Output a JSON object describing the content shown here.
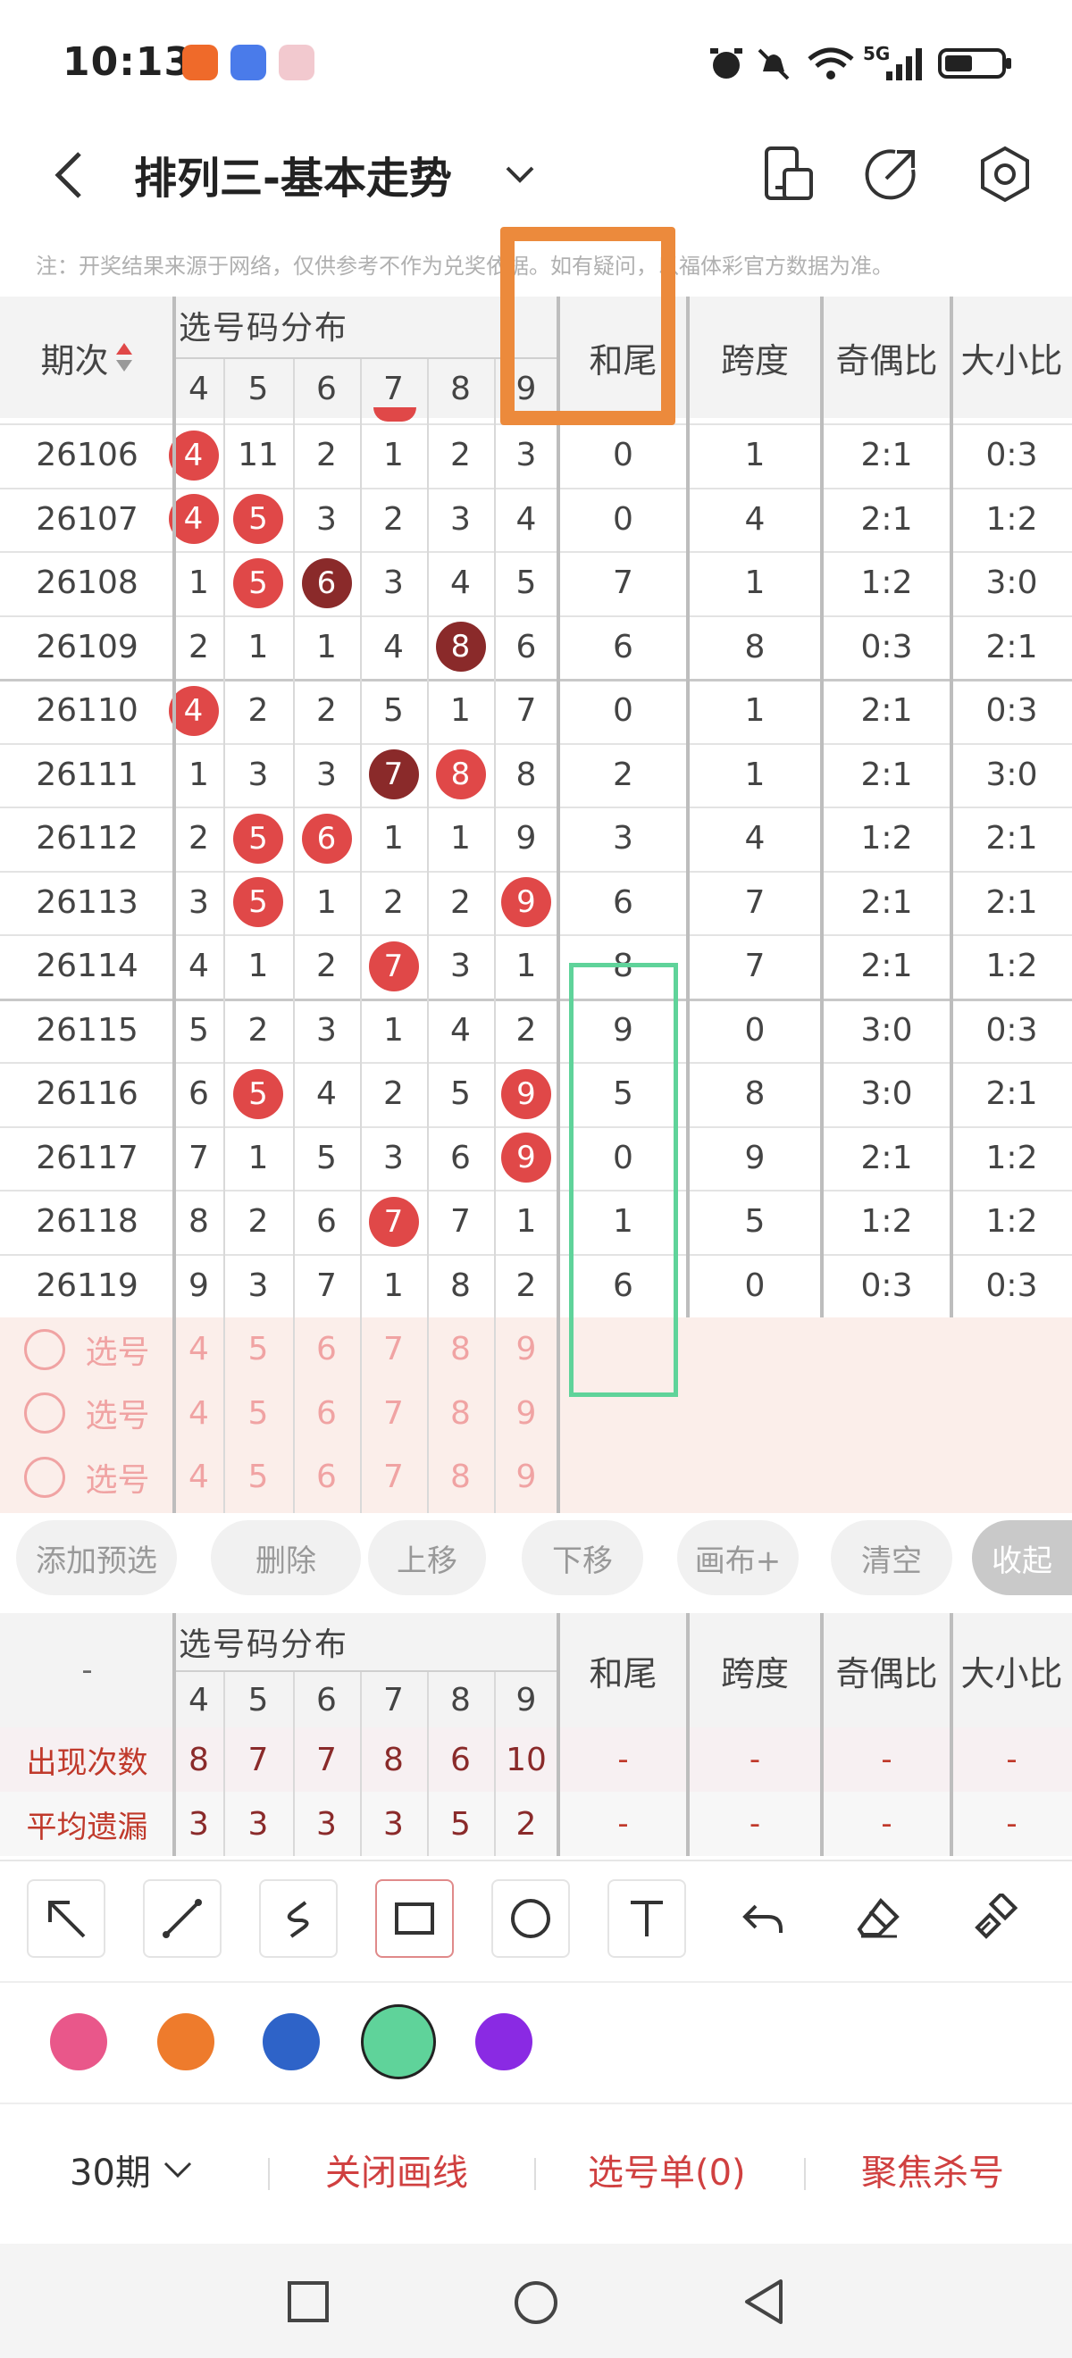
{
  "status_bar": {
    "time": "10:13",
    "network": "5G"
  },
  "header": {
    "title": "排列三-基本走势"
  },
  "notice": "注：开奖结果来源于网络，仅供参考不作为兑奖依据。如有疑问，以福体彩官方数据为准。",
  "table": {
    "issue_header": "期次",
    "group_header": "选号码分布",
    "columns": [
      "和尾",
      "跨度",
      "奇偶比",
      "大小比"
    ],
    "digits": [
      "4",
      "5",
      "6",
      "7",
      "8",
      "9"
    ],
    "rows": [
      {
        "issue": "26106",
        "d": [
          "4",
          "11",
          "2",
          "1",
          "2",
          "3"
        ],
        "b": [
          "red",
          "",
          "",
          "",
          "",
          ""
        ],
        "hw": "0",
        "kd": "1",
        "jo": "2:1",
        "dx": "0:3"
      },
      {
        "issue": "26107",
        "d": [
          "4",
          "5",
          "3",
          "2",
          "3",
          "4"
        ],
        "b": [
          "red",
          "red",
          "",
          "",
          "",
          ""
        ],
        "hw": "0",
        "kd": "4",
        "jo": "2:1",
        "dx": "1:2"
      },
      {
        "issue": "26108",
        "d": [
          "1",
          "5",
          "6",
          "3",
          "4",
          "5"
        ],
        "b": [
          "",
          "red",
          "dark",
          "",
          "",
          ""
        ],
        "hw": "7",
        "kd": "1",
        "jo": "1:2",
        "dx": "3:0"
      },
      {
        "issue": "26109",
        "d": [
          "2",
          "1",
          "1",
          "4",
          "8",
          "6"
        ],
        "b": [
          "",
          "",
          "",
          "",
          "dark",
          ""
        ],
        "hw": "6",
        "kd": "8",
        "jo": "0:3",
        "dx": "2:1"
      },
      {
        "issue": "26110",
        "d": [
          "4",
          "2",
          "2",
          "5",
          "1",
          "7"
        ],
        "b": [
          "red",
          "",
          "",
          "",
          "",
          ""
        ],
        "hw": "0",
        "kd": "1",
        "jo": "2:1",
        "dx": "0:3"
      },
      {
        "issue": "26111",
        "d": [
          "1",
          "3",
          "3",
          "7",
          "8",
          "8"
        ],
        "b": [
          "",
          "",
          "",
          "dark",
          "red",
          ""
        ],
        "hw": "2",
        "kd": "1",
        "jo": "2:1",
        "dx": "3:0"
      },
      {
        "issue": "26112",
        "d": [
          "2",
          "5",
          "6",
          "1",
          "1",
          "9"
        ],
        "b": [
          "",
          "red",
          "red",
          "",
          "",
          ""
        ],
        "hw": "3",
        "kd": "4",
        "jo": "1:2",
        "dx": "2:1"
      },
      {
        "issue": "26113",
        "d": [
          "3",
          "5",
          "1",
          "2",
          "2",
          "9"
        ],
        "b": [
          "",
          "red",
          "",
          "",
          "",
          "red"
        ],
        "hw": "6",
        "kd": "7",
        "jo": "2:1",
        "dx": "2:1"
      },
      {
        "issue": "26114",
        "d": [
          "4",
          "1",
          "2",
          "7",
          "3",
          "1"
        ],
        "b": [
          "",
          "",
          "",
          "red",
          "",
          ""
        ],
        "hw": "8",
        "kd": "7",
        "jo": "2:1",
        "dx": "1:2"
      },
      {
        "issue": "26115",
        "d": [
          "5",
          "2",
          "3",
          "1",
          "4",
          "2"
        ],
        "b": [
          "",
          "",
          "",
          "",
          "",
          ""
        ],
        "hw": "9",
        "kd": "0",
        "jo": "3:0",
        "dx": "0:3"
      },
      {
        "issue": "26116",
        "d": [
          "6",
          "5",
          "4",
          "2",
          "5",
          "9"
        ],
        "b": [
          "",
          "red",
          "",
          "",
          "",
          "red"
        ],
        "hw": "5",
        "kd": "8",
        "jo": "3:0",
        "dx": "2:1"
      },
      {
        "issue": "26117",
        "d": [
          "7",
          "1",
          "5",
          "3",
          "6",
          "9"
        ],
        "b": [
          "",
          "",
          "",
          "",
          "",
          "red"
        ],
        "hw": "0",
        "kd": "9",
        "jo": "2:1",
        "dx": "1:2"
      },
      {
        "issue": "26118",
        "d": [
          "8",
          "2",
          "6",
          "7",
          "7",
          "1"
        ],
        "b": [
          "",
          "",
          "",
          "red",
          "",
          ""
        ],
        "hw": "1",
        "kd": "5",
        "jo": "1:2",
        "dx": "1:2"
      },
      {
        "issue": "26119",
        "d": [
          "9",
          "3",
          "7",
          "1",
          "8",
          "2"
        ],
        "b": [
          "",
          "",
          "",
          "",
          "",
          ""
        ],
        "hw": "6",
        "kd": "0",
        "jo": "0:3",
        "dx": "0:3"
      }
    ],
    "pick_label": "选号",
    "pick_rows": 3
  },
  "actions": [
    "添加预选",
    "删除",
    "上移",
    "下移",
    "画布+",
    "清空",
    "收起"
  ],
  "stats": {
    "dash": "-",
    "rows": [
      {
        "label": "出现次数",
        "d": [
          "8",
          "7",
          "7",
          "8",
          "6",
          "10"
        ],
        "rest": [
          "-",
          "-",
          "-",
          "-"
        ]
      },
      {
        "label": "平均遗漏",
        "d": [
          "3",
          "3",
          "3",
          "3",
          "5",
          "2"
        ],
        "rest": [
          "-",
          "-",
          "-",
          "-"
        ]
      }
    ]
  },
  "tools": [
    "arrow-tool",
    "line-tool",
    "freehand-tool",
    "rectangle-tool",
    "circle-tool",
    "text-tool",
    "undo-tool",
    "eraser-tool",
    "clear-brush-tool"
  ],
  "colors": [
    "#e9578a",
    "#ee7b2c",
    "#2e63c8",
    "#5fd39a",
    "#8a2ae3"
  ],
  "bottom": {
    "period": "30期",
    "close_draw": "关闭画线",
    "pick_list": "选号单(0)",
    "focus_kill": "聚焦杀号"
  }
}
